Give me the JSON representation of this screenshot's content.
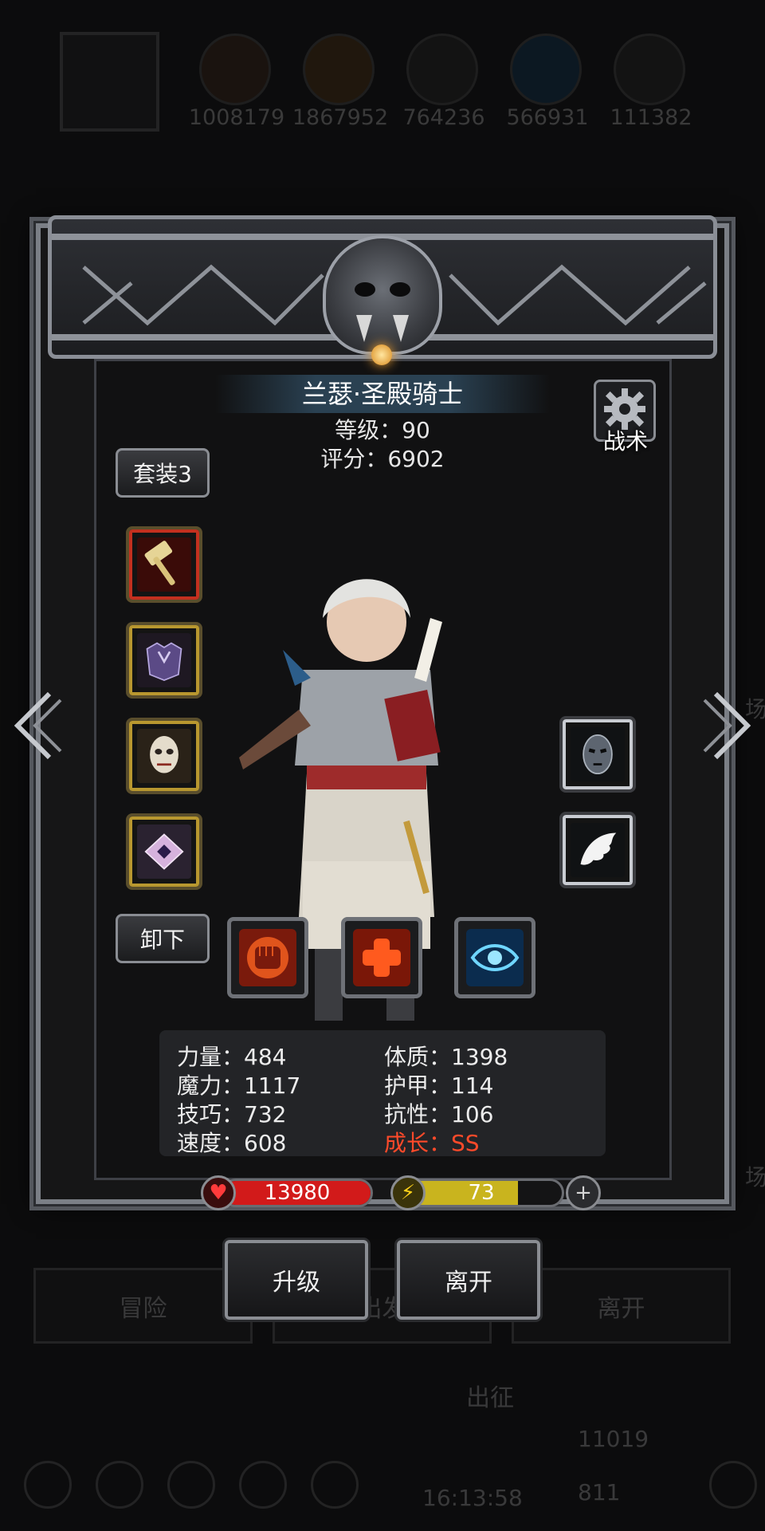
{
  "background": {
    "resources": [
      "1008179",
      "1867952",
      "764236",
      "566931",
      "111382"
    ],
    "buttons": [
      "冒险",
      "出发",
      "离开"
    ],
    "section_label": "出征",
    "timer": "16:13:58",
    "count_1": "11019",
    "count_2": "811",
    "side_text": "场"
  },
  "hero": {
    "name": "兰瑟·圣殿骑士",
    "level_text": "等级：90",
    "score_text": "评分：6902"
  },
  "buttons": {
    "set": "套装3",
    "unequip": "卸下",
    "tactics": "战术",
    "upgrade": "升级",
    "leave": "离开"
  },
  "equipment": {
    "left": [
      "hammer-icon",
      "armor-icon",
      "mask-icon",
      "rune-tile-icon"
    ],
    "right": [
      "iron-mask-icon",
      "wing-icon"
    ]
  },
  "skills": [
    "fist-icon",
    "heal-cross-icon",
    "eye-icon"
  ],
  "stats": {
    "left": [
      "力量：484",
      "魔力：1117",
      "技巧：732",
      "速度：608"
    ],
    "right": [
      "体质：1398",
      "护甲：114",
      "抗性：106",
      "成长：SS"
    ]
  },
  "bars": {
    "hp": "13980",
    "energy": "73",
    "energy_fraction": 0.73,
    "hp_color": "#d21a1a",
    "energy_color": "#c9b41e"
  },
  "colors": {
    "highlight": "#ff4a2a",
    "frame": "#7b7f86"
  }
}
